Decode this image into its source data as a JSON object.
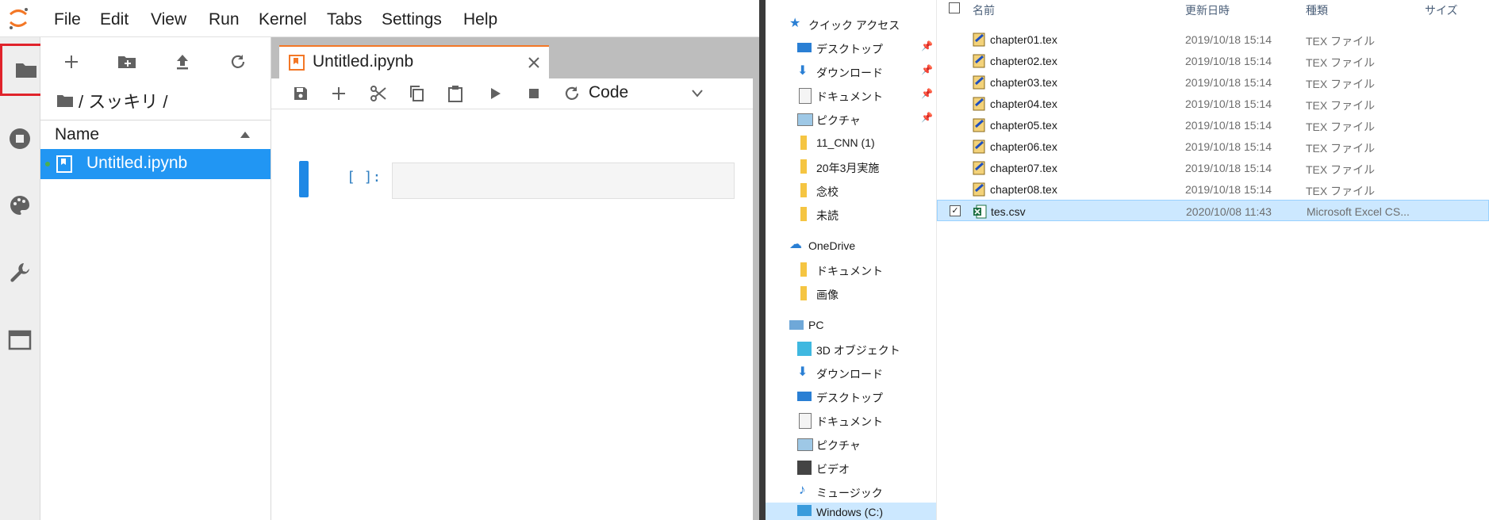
{
  "menu": [
    "File",
    "Edit",
    "View",
    "Run",
    "Kernel",
    "Tabs",
    "Settings",
    "Help"
  ],
  "filebrowser": {
    "breadcrumb": "/ スッキリ /",
    "column_name": "Name",
    "files": [
      {
        "name": "Untitled.ipynb",
        "selected": true
      }
    ]
  },
  "notebook": {
    "tab_title": "Untitled.ipynb",
    "cell_type": "Code",
    "prompt": "[ ]:"
  },
  "explorer": {
    "nav": {
      "quick_access": "クイック アクセス",
      "quick_items": [
        "デスクトップ",
        "ダウンロード",
        "ドキュメント",
        "ピクチャ",
        "11_CNN (1)",
        "20年3月実施",
        "念校",
        "未読"
      ],
      "onedrive": "OneDrive",
      "onedrive_items": [
        "ドキュメント",
        "画像"
      ],
      "pc": "PC",
      "pc_items": [
        "3D オブジェクト",
        "ダウンロード",
        "デスクトップ",
        "ドキュメント",
        "ピクチャ",
        "ビデオ",
        "ミュージック",
        "Windows (C:)"
      ]
    },
    "columns": {
      "name": "名前",
      "date": "更新日時",
      "type": "種類",
      "size": "サイズ"
    },
    "files": [
      {
        "name": "chapter01.tex",
        "date": "2019/10/18 15:14",
        "type": "TEX ファイル"
      },
      {
        "name": "chapter02.tex",
        "date": "2019/10/18 15:14",
        "type": "TEX ファイル"
      },
      {
        "name": "chapter03.tex",
        "date": "2019/10/18 15:14",
        "type": "TEX ファイル"
      },
      {
        "name": "chapter04.tex",
        "date": "2019/10/18 15:14",
        "type": "TEX ファイル"
      },
      {
        "name": "chapter05.tex",
        "date": "2019/10/18 15:14",
        "type": "TEX ファイル"
      },
      {
        "name": "chapter06.tex",
        "date": "2019/10/18 15:14",
        "type": "TEX ファイル"
      },
      {
        "name": "chapter07.tex",
        "date": "2019/10/18 15:14",
        "type": "TEX ファイル"
      },
      {
        "name": "chapter08.tex",
        "date": "2019/10/18 15:14",
        "type": "TEX ファイル"
      },
      {
        "name": "tes.csv",
        "date": "2020/10/08 11:43",
        "type": "Microsoft Excel CS...",
        "selected": true
      }
    ]
  },
  "colors": {
    "accent_blue": "#2196f3",
    "highlight_red": "#e0232b",
    "jupyter_orange": "#f37726",
    "explorer_select": "#cce8ff"
  }
}
